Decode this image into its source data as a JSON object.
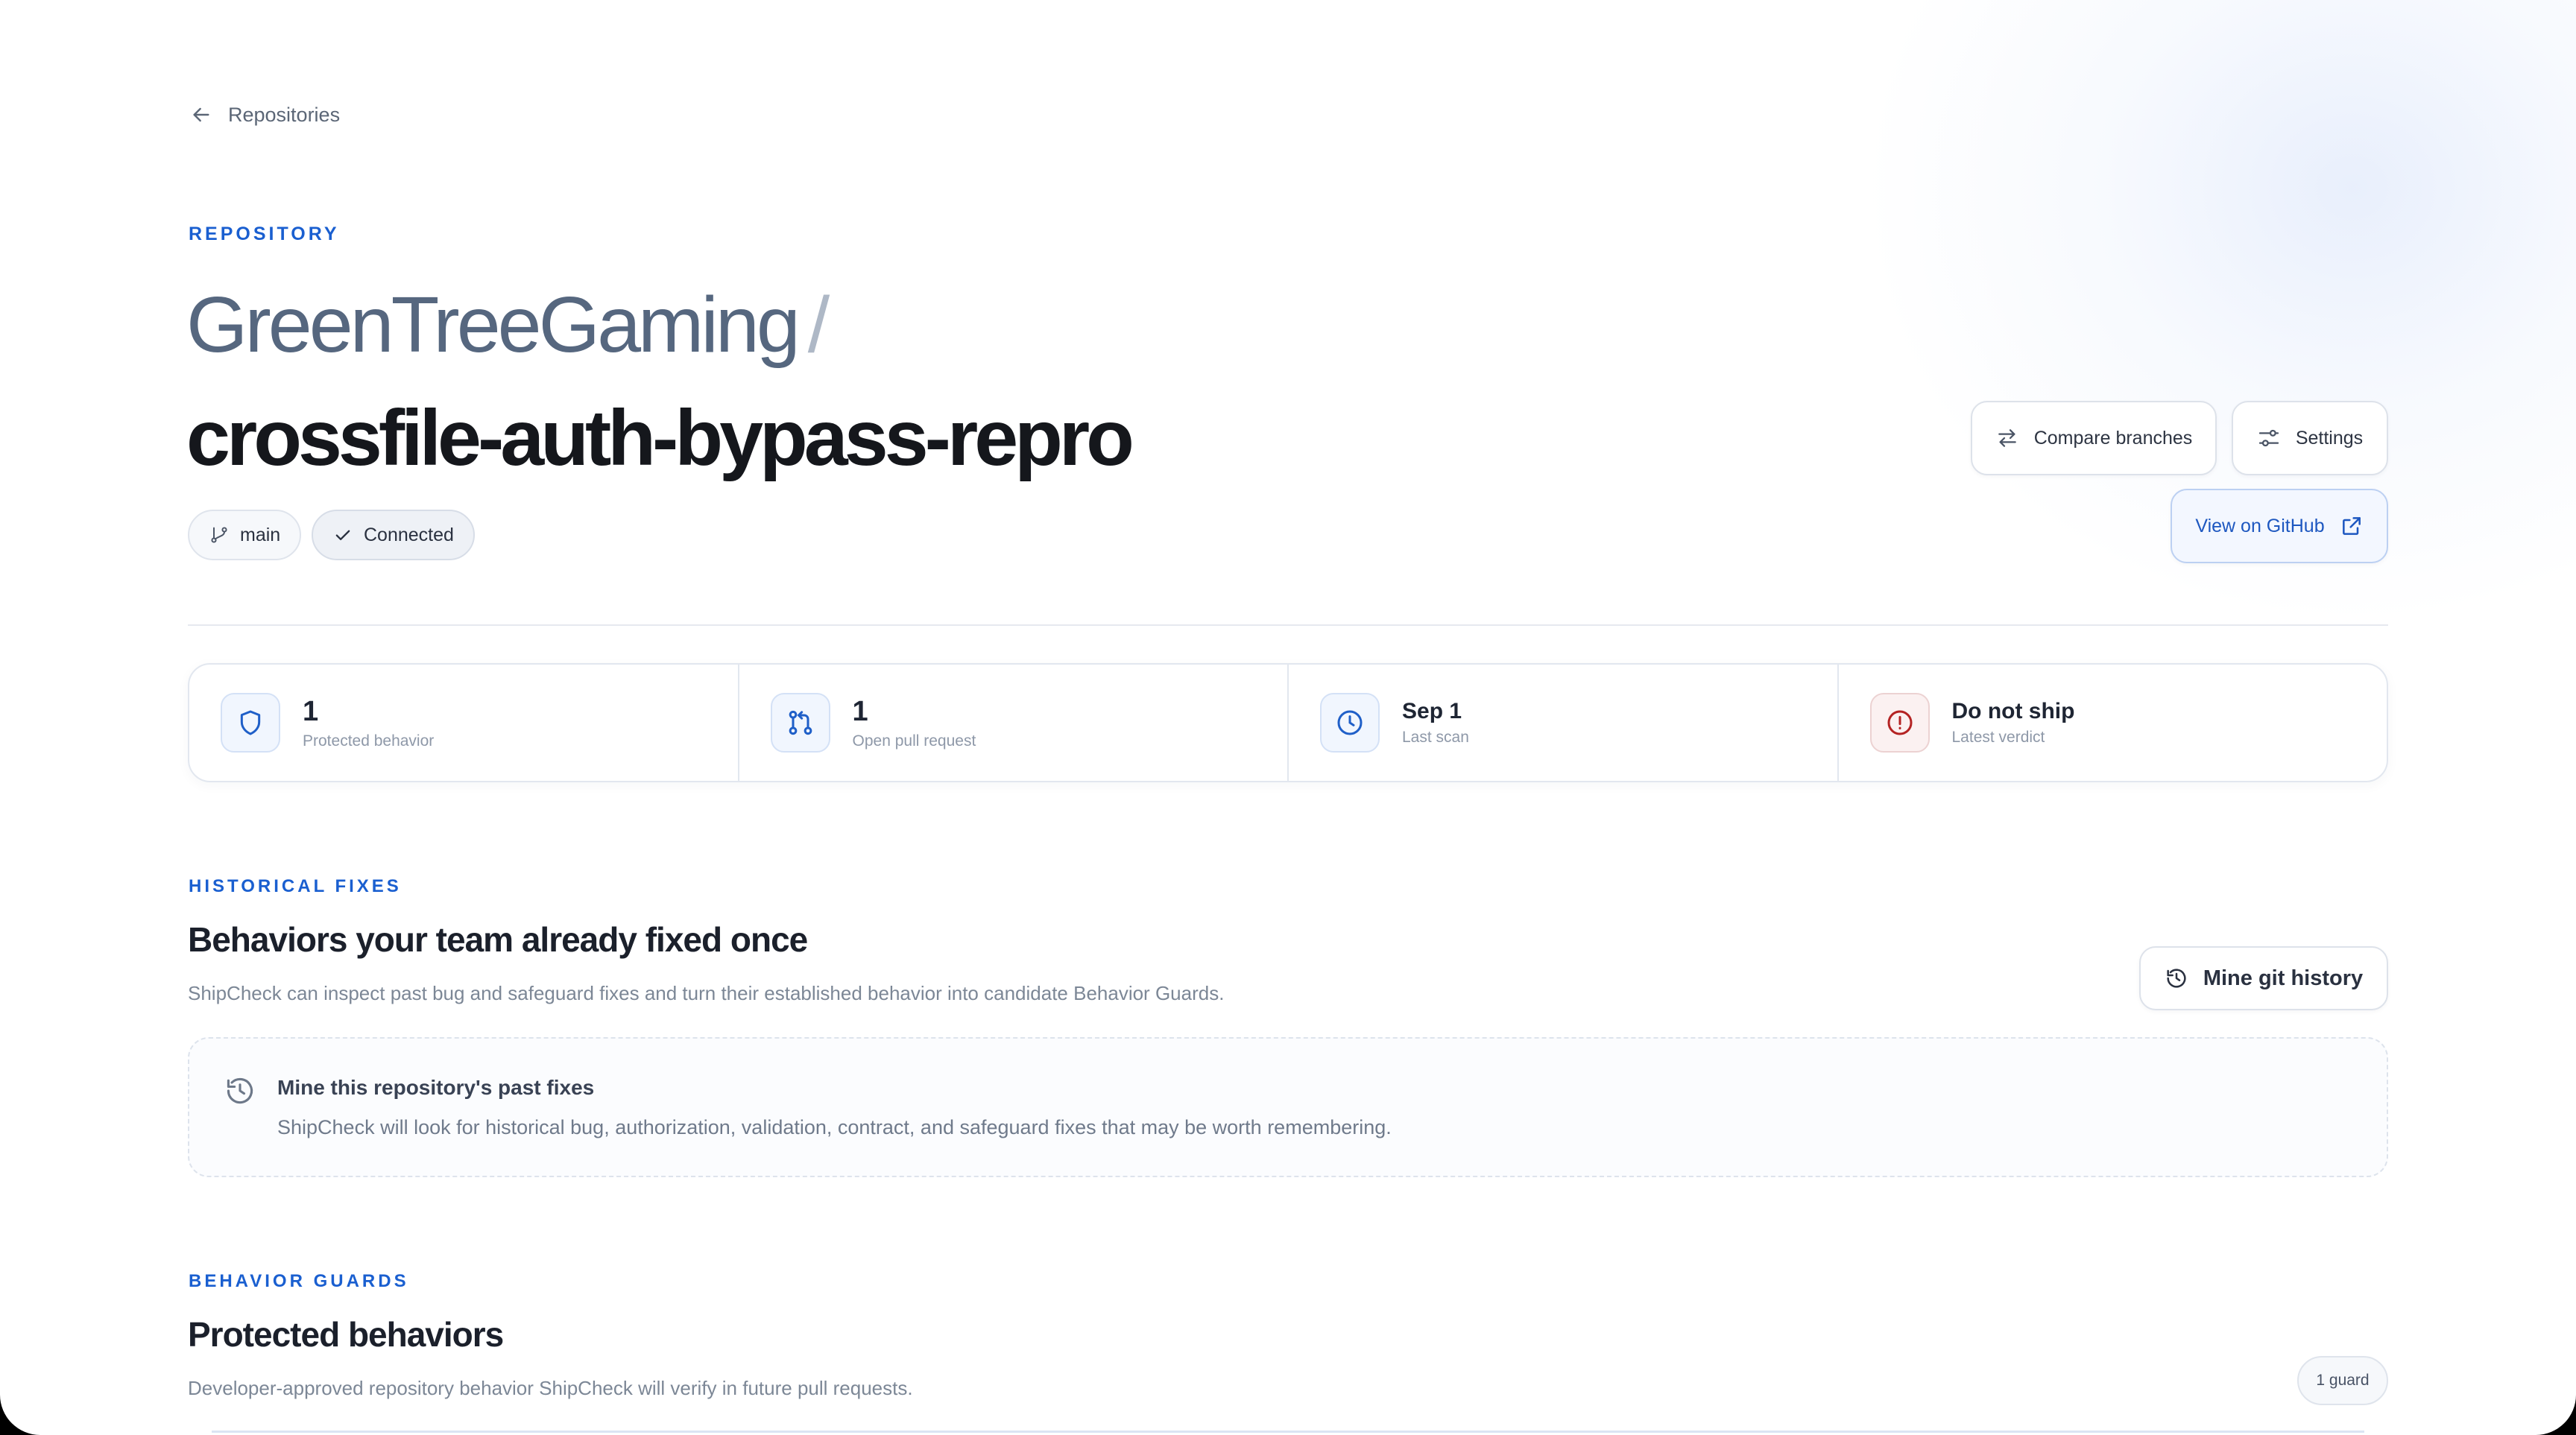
{
  "back_link": {
    "label": "Repositories"
  },
  "header": {
    "eyebrow": "REPOSITORY",
    "org": "GreenTreeGaming",
    "separator": "/",
    "repo": "crossfile-auth-bypass-repro",
    "chips": {
      "branch": "main",
      "status": "Connected"
    },
    "actions": {
      "compare_branches": "Compare branches",
      "settings": "Settings",
      "view_on_github": "View on GitHub"
    }
  },
  "stats": [
    {
      "value": "1",
      "label": "Protected behavior",
      "icon": "shield-icon"
    },
    {
      "value": "1",
      "label": "Open pull request",
      "icon": "pull-request-icon"
    },
    {
      "value": "Sep 1",
      "label": "Last scan",
      "icon": "clock-icon"
    },
    {
      "value": "Do not ship",
      "label": "Latest verdict",
      "icon": "alert-circle-icon"
    }
  ],
  "historical_fixes": {
    "eyebrow": "HISTORICAL FIXES",
    "title": "Behaviors your team already fixed once",
    "description": "ShipCheck can inspect past bug and safeguard fixes and turn their established behavior into candidate Behavior Guards.",
    "action": "Mine git history",
    "empty_state": {
      "title": "Mine this repository's past fixes",
      "description": "ShipCheck will look for historical bug, authorization, validation, contract, and safeguard fixes that may be worth remembering."
    }
  },
  "behavior_guards": {
    "eyebrow": "BEHAVIOR GUARDS",
    "title": "Protected behaviors",
    "description": "Developer-approved repository behavior ShipCheck will verify in future pull requests.",
    "count_badge": "1 guard"
  },
  "colors": {
    "accent": "#1a5fd0",
    "danger": "#b42323",
    "text_primary": "#15171c",
    "text_muted": "#7c8796"
  }
}
